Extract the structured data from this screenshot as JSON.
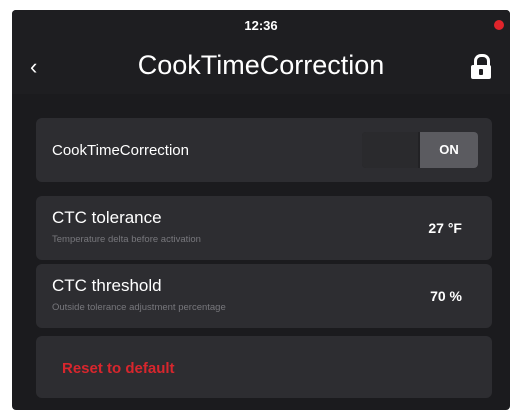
{
  "status_bar": {
    "time": "12:36"
  },
  "header": {
    "title": "CookTimeCorrection",
    "back_icon": "chevron-left-icon",
    "lock_icon": "lock-icon"
  },
  "settings": {
    "cook_time_correction": {
      "label": "CookTimeCorrection",
      "toggle_state": "ON"
    },
    "ctc_tolerance": {
      "label": "CTC tolerance",
      "description": "Temperature delta before activation",
      "value": "27 °F"
    },
    "ctc_threshold": {
      "label": "CTC threshold",
      "description": "Outside tolerance adjustment percentage",
      "value": "70 %"
    },
    "reset": {
      "label": "Reset to default"
    }
  },
  "colors": {
    "background": "#1b1b1e",
    "card": "#2d2d31",
    "accent_red": "#d8262d"
  }
}
